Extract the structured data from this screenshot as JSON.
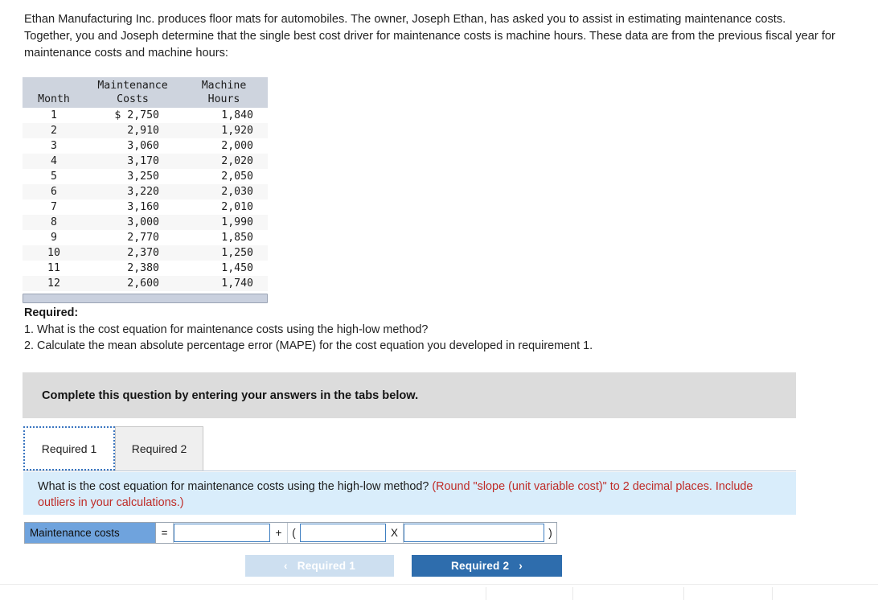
{
  "intro": {
    "paragraph": "Ethan Manufacturing Inc. produces floor mats for automobiles. The owner, Joseph Ethan, has asked you to assist in estimating maintenance costs. Together, you and Joseph determine that the single best cost driver for maintenance costs is machine hours. These data are from the previous fiscal year for maintenance costs and machine hours:"
  },
  "data_table": {
    "headers": {
      "month": "Month",
      "maintenance_costs": "Maintenance\nCosts",
      "machine_hours": "Machine\nHours"
    },
    "rows": [
      {
        "month": "1",
        "cost": "$ 2,750",
        "hours": "1,840"
      },
      {
        "month": "2",
        "cost": "2,910",
        "hours": "1,920"
      },
      {
        "month": "3",
        "cost": "3,060",
        "hours": "2,000"
      },
      {
        "month": "4",
        "cost": "3,170",
        "hours": "2,020"
      },
      {
        "month": "5",
        "cost": "3,250",
        "hours": "2,050"
      },
      {
        "month": "6",
        "cost": "3,220",
        "hours": "2,030"
      },
      {
        "month": "7",
        "cost": "3,160",
        "hours": "2,010"
      },
      {
        "month": "8",
        "cost": "3,000",
        "hours": "1,990"
      },
      {
        "month": "9",
        "cost": "2,770",
        "hours": "1,850"
      },
      {
        "month": "10",
        "cost": "2,370",
        "hours": "1,250"
      },
      {
        "month": "11",
        "cost": "2,380",
        "hours": "1,450"
      },
      {
        "month": "12",
        "cost": "2,600",
        "hours": "1,740"
      }
    ]
  },
  "required": {
    "title": "Required:",
    "item1": "1. What is the cost equation for maintenance costs using the high-low method?",
    "item2": "2. Calculate the mean absolute percentage error (MAPE) for the cost equation you developed in requirement 1."
  },
  "banner": {
    "text": "Complete this question by entering your answers in the tabs below."
  },
  "tabs": [
    {
      "label": "Required 1",
      "active": true
    },
    {
      "label": "Required 2",
      "active": false
    }
  ],
  "question_panel": {
    "question": "What is the cost equation for maintenance costs using the high-low method?",
    "hint": "(Round \"slope (unit variable cost)\" to 2 decimal places. Include outliers in your calculations.)"
  },
  "equation": {
    "label": "Maintenance costs",
    "equals": "=",
    "plus": "+",
    "open_paren": "(",
    "times": "X",
    "close_paren": ")",
    "intercept_value": "",
    "slope_value": "",
    "driver_value": "",
    "placeholder": ""
  },
  "navigation": {
    "prev_label": "Required 1",
    "prev_chevron": "‹",
    "next_label": "Required 2",
    "next_chevron": "›"
  },
  "colors": {
    "table_header_bg": "#ced4de",
    "banner_bg": "#dcdcdc",
    "panel_bg": "#d9edfb",
    "hint_red": "#bf2c28",
    "label_blue": "#6fa3dd",
    "input_border_blue": "#3f7fc1",
    "next_button_blue": "#2e6dad",
    "prev_button_blue": "#cddff0"
  }
}
